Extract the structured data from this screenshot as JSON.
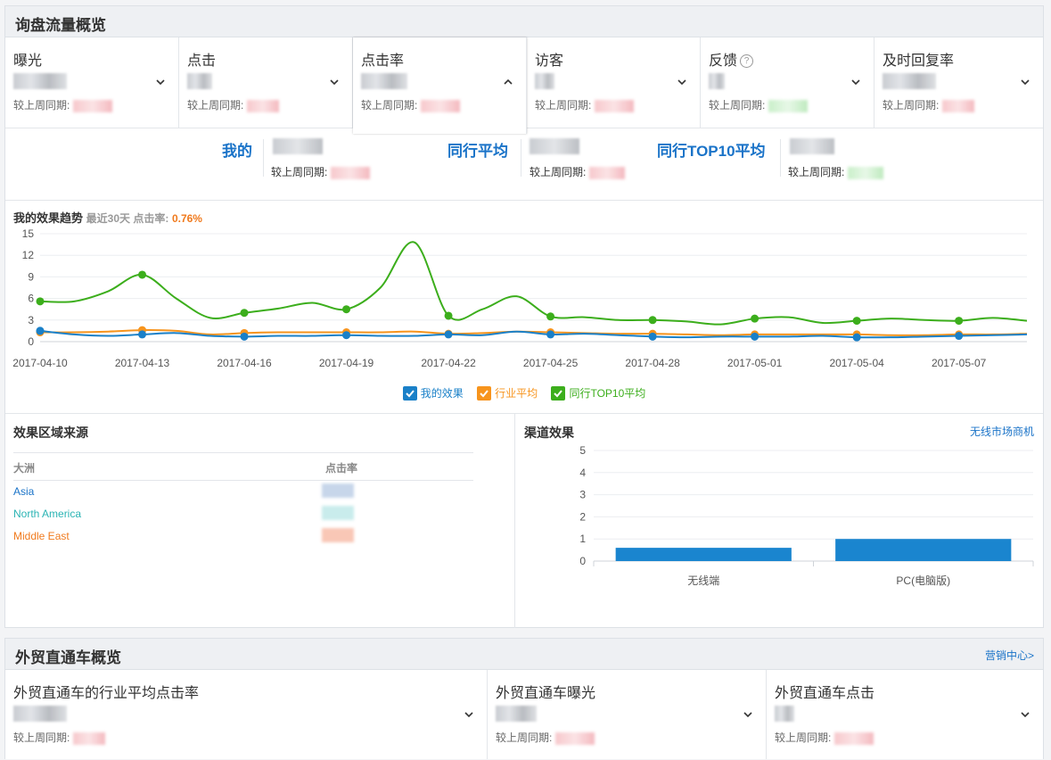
{
  "inquiry_panel": {
    "title": "询盘流量概览",
    "compare_label": "较上周同期:",
    "kpis": [
      {
        "label": "曝光",
        "help": false,
        "active": false,
        "compare_tint": "pink"
      },
      {
        "label": "点击",
        "help": false,
        "active": false,
        "compare_tint": "pink"
      },
      {
        "label": "点击率",
        "help": false,
        "active": true,
        "compare_tint": "pink"
      },
      {
        "label": "访客",
        "help": false,
        "active": false,
        "compare_tint": "pink"
      },
      {
        "label": "反馈",
        "help": true,
        "active": false,
        "compare_tint": "green"
      },
      {
        "label": "及时回复率",
        "help": false,
        "active": false,
        "compare_tint": "pink"
      }
    ],
    "compare": {
      "mine": "我的",
      "peer_avg": "同行平均",
      "peer_top10": "同行TOP10平均",
      "compare_label": "较上周同期:"
    },
    "trend": {
      "title": "我的效果趋势",
      "period": "最近30天 点击率:",
      "rate": "0.76%"
    },
    "legend": {
      "mine": "我的效果",
      "industry": "行业平均",
      "top10": "同行TOP10平均"
    },
    "region": {
      "title": "效果区域来源",
      "col_continent": "大洲",
      "col_rate": "点击率",
      "rows": [
        {
          "name": "Asia",
          "color": "#1a73c8",
          "blur": "#c7d6ea"
        },
        {
          "name": "North America",
          "color": "#2bb4b4",
          "blur": "#c9ecec"
        },
        {
          "name": "Middle East",
          "color": "#f07a1d",
          "blur": "#f9c7b6"
        }
      ]
    },
    "channel": {
      "title": "渠道效果",
      "link": "无线市场商机"
    }
  },
  "p4p_panel": {
    "title": "外贸直通车概览",
    "link": "营销中心>",
    "compare_label": "较上周同期:",
    "kpis": [
      {
        "label": "外贸直通车的行业平均点击率"
      },
      {
        "label": "外贸直通车曝光"
      },
      {
        "label": "外贸直通车点击"
      }
    ]
  },
  "colors": {
    "mine": "#1a80c8",
    "industry": "#f7941d",
    "top10": "#3cae1c",
    "bar": "#1a85cf"
  },
  "chart_data": [
    {
      "type": "line",
      "x": [
        "2017-04-10",
        "2017-04-11",
        "2017-04-12",
        "2017-04-13",
        "2017-04-14",
        "2017-04-15",
        "2017-04-16",
        "2017-04-17",
        "2017-04-18",
        "2017-04-19",
        "2017-04-20",
        "2017-04-21",
        "2017-04-22",
        "2017-04-23",
        "2017-04-24",
        "2017-04-25",
        "2017-04-26",
        "2017-04-27",
        "2017-04-28",
        "2017-04-29",
        "2017-04-30",
        "2017-05-01",
        "2017-05-02",
        "2017-05-03",
        "2017-05-04",
        "2017-05-05",
        "2017-05-06",
        "2017-05-07",
        "2017-05-08",
        "2017-05-09"
      ],
      "x_ticks": [
        "2017-04-10",
        "2017-04-13",
        "2017-04-16",
        "2017-04-19",
        "2017-04-22",
        "2017-04-25",
        "2017-04-28",
        "2017-05-01",
        "2017-05-04",
        "2017-05-07"
      ],
      "series": [
        {
          "name": "我的效果",
          "values": [
            1.5,
            1.0,
            0.8,
            1.0,
            1.2,
            0.8,
            0.7,
            0.8,
            0.8,
            0.9,
            0.8,
            0.8,
            1.0,
            0.9,
            1.4,
            1.0,
            1.1,
            0.9,
            0.7,
            0.6,
            0.7,
            0.7,
            0.7,
            0.8,
            0.6,
            0.6,
            0.7,
            0.8,
            0.9,
            1.0
          ]
        },
        {
          "name": "行业平均",
          "values": [
            1.3,
            1.3,
            1.4,
            1.6,
            1.5,
            1.0,
            1.2,
            1.3,
            1.3,
            1.3,
            1.3,
            1.4,
            1.1,
            1.2,
            1.4,
            1.3,
            1.2,
            1.1,
            1.1,
            1.0,
            0.9,
            1.0,
            1.0,
            1.0,
            1.0,
            0.9,
            0.9,
            1.0,
            1.0,
            1.1
          ]
        },
        {
          "name": "同行TOP10平均",
          "values": [
            5.6,
            5.6,
            7.0,
            9.3,
            6.0,
            3.3,
            4.0,
            4.6,
            5.4,
            4.5,
            7.5,
            13.8,
            3.6,
            4.5,
            6.3,
            3.5,
            3.4,
            3.0,
            3.0,
            2.8,
            2.4,
            3.2,
            3.4,
            2.6,
            2.9,
            3.2,
            3.0,
            2.9,
            3.3,
            2.9
          ]
        }
      ],
      "ylim": [
        0,
        15
      ],
      "yticks": [
        0,
        3,
        6,
        9,
        12,
        15
      ],
      "grid": true,
      "legend": "bottom-center"
    },
    {
      "type": "bar",
      "categories": [
        "无线端",
        "PC(电脑版)"
      ],
      "values": [
        0.6,
        1.0
      ],
      "ylim": [
        0,
        5
      ],
      "yticks": [
        0,
        1,
        2,
        3,
        4,
        5
      ],
      "grid": true
    }
  ]
}
